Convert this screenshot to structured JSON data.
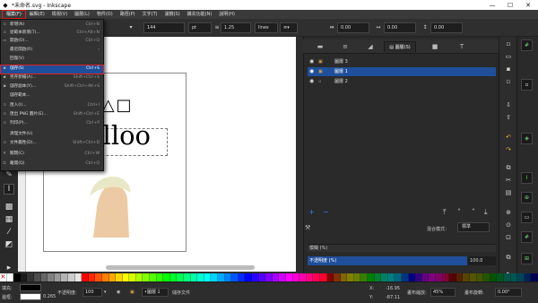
{
  "window": {
    "title": "*未命名.svg - Inkscape",
    "minimize": "—",
    "maximize": "☐",
    "close": "✕"
  },
  "menubar": [
    "檔案(F)",
    "編輯(E)",
    "檢視(V)",
    "圖層(L)",
    "物件(O)",
    "路徑(P)",
    "文字(T)",
    "濾鏡(S)",
    "擴充功能(N)",
    "說明(H)"
  ],
  "file_menu": [
    {
      "icon": "new-doc-icon",
      "glyph": "▫",
      "label": "新增(N)",
      "shortcut": "Ctrl+N"
    },
    {
      "icon": "template-icon",
      "glyph": "▫",
      "label": "從範本新增(T)...",
      "shortcut": "Ctrl+Alt+N"
    },
    {
      "icon": "open-icon",
      "glyph": "▭",
      "label": "開啟(O)...",
      "shortcut": "Ctrl+O"
    },
    {
      "icon": "recent-icon",
      "glyph": "",
      "label": "最近開啟(R)",
      "shortcut": ""
    },
    {
      "icon": "revert-icon",
      "glyph": "",
      "label": "回復(V)",
      "shortcut": ""
    },
    {
      "icon": "save-icon",
      "glyph": "▪",
      "label": "儲存(S)",
      "shortcut": "Ctrl+S"
    },
    {
      "icon": "save-as-icon",
      "glyph": "▪",
      "label": "另存新檔(A)...",
      "shortcut": "Shift+Ctrl+S"
    },
    {
      "icon": "save-copy-icon",
      "glyph": "▪",
      "label": "儲存副本(Y)...",
      "shortcut": "Shift+Ctrl+Alt+S"
    },
    {
      "icon": "save-template-icon",
      "glyph": "",
      "label": "儲存範本...",
      "shortcut": ""
    },
    {
      "icon": "import-icon",
      "glyph": "▫",
      "label": "匯入(I)...",
      "shortcut": "Ctrl+I"
    },
    {
      "icon": "export-png-icon",
      "glyph": "▫",
      "label": "匯出 PNG 圖片(E)...",
      "shortcut": "Shift+Ctrl+E"
    },
    {
      "icon": "print-icon",
      "glyph": "▫",
      "label": "列印(P)...",
      "shortcut": "Ctrl+P"
    },
    {
      "icon": "cleanup-icon",
      "glyph": "",
      "label": "清理文件(U)",
      "shortcut": ""
    },
    {
      "icon": "doc-props-icon",
      "glyph": "▫",
      "label": "文件屬性(D)...",
      "shortcut": "Shift+Ctrl+D"
    },
    {
      "icon": "close-doc-icon",
      "glyph": "✕",
      "label": "關閉(C)",
      "shortcut": "Ctrl+W"
    },
    {
      "icon": "quit-icon",
      "glyph": "⏻",
      "label": "離開(Q)",
      "shortcut": "Ctrl+Q"
    }
  ],
  "toolbar": {
    "font_size": "144",
    "unit": "pt",
    "line_spacing": "1.25",
    "line_unit": "lines",
    "fields_right": [
      "0.00",
      "0.00",
      "0.00"
    ]
  },
  "canvas": {
    "text": "Lalloo",
    "shapes": "○△□"
  },
  "dock": {
    "tabs": [
      {
        "icon": "fill-stroke-icon",
        "glyph": "▬"
      },
      {
        "icon": "align-icon",
        "glyph": "≡"
      },
      {
        "icon": "xml-icon",
        "glyph": "◢"
      },
      {
        "label": "圖層(S)",
        "glyph": "▤"
      },
      {
        "icon": "symbols-icon",
        "glyph": "■"
      },
      {
        "icon": "text-font-icon",
        "glyph": "T"
      }
    ],
    "layers": [
      {
        "name": "圖層 3",
        "selected": false,
        "locked": true
      },
      {
        "name": "圖層 1",
        "selected": true,
        "locked": true
      },
      {
        "name": "圖層 2",
        "selected": false,
        "locked": false
      }
    ],
    "blend_label": "混合模式：",
    "blend_value": "標準",
    "opacity_header": "模糊 (%)",
    "opacity_label": "不透明度 (%)",
    "opacity_value": "100.0"
  },
  "palette": [
    "#ffffff",
    "#000000",
    "#1a1a1a",
    "#333333",
    "#4d4d4d",
    "#666666",
    "#808080",
    "#999999",
    "#b3b3b3",
    "#cccccc",
    "#e6e6e6",
    "#ff0000",
    "#ff2a00",
    "#ff5500",
    "#ff8000",
    "#ffaa00",
    "#ffd500",
    "#ffff00",
    "#d4ff00",
    "#aaff00",
    "#80ff00",
    "#55ff00",
    "#2bff00",
    "#00ff00",
    "#00ff2a",
    "#00ff55",
    "#00ff80",
    "#00ffaa",
    "#00ffd5",
    "#00ffff",
    "#00d4ff",
    "#00aaff",
    "#0080ff",
    "#0055ff",
    "#002aff",
    "#0000ff",
    "#2a00ff",
    "#5500ff",
    "#8000ff",
    "#aa00ff",
    "#d400ff",
    "#ff00ff",
    "#ff00d4",
    "#ff00aa",
    "#ff0080",
    "#ff0055",
    "#ff002a",
    "#800000",
    "#803300",
    "#806600",
    "#808000",
    "#668000",
    "#338000",
    "#008000",
    "#008033",
    "#008066",
    "#008080",
    "#006680",
    "#003380",
    "#000080",
    "#330080",
    "#660080",
    "#800080",
    "#800066",
    "#800033",
    "#550000",
    "#552200",
    "#554400",
    "#555500",
    "#445500",
    "#225500",
    "#005500",
    "#005522",
    "#005544",
    "#005555",
    "#004455",
    "#002255",
    "#000055"
  ],
  "status": {
    "fill_label": "填充:",
    "stroke_label": "邊框:",
    "stroke_width": "0.265",
    "opacity_label": "不透明度:",
    "opacity_value": "100",
    "layer_value": "•圖層 1",
    "message": "儲存文件",
    "x": "-16.95",
    "y": "-87.11",
    "zoom_label": "畫布縮放:",
    "zoom": "45%",
    "rotate_label": "畫布旋轉:",
    "rotate": "0.00°"
  }
}
